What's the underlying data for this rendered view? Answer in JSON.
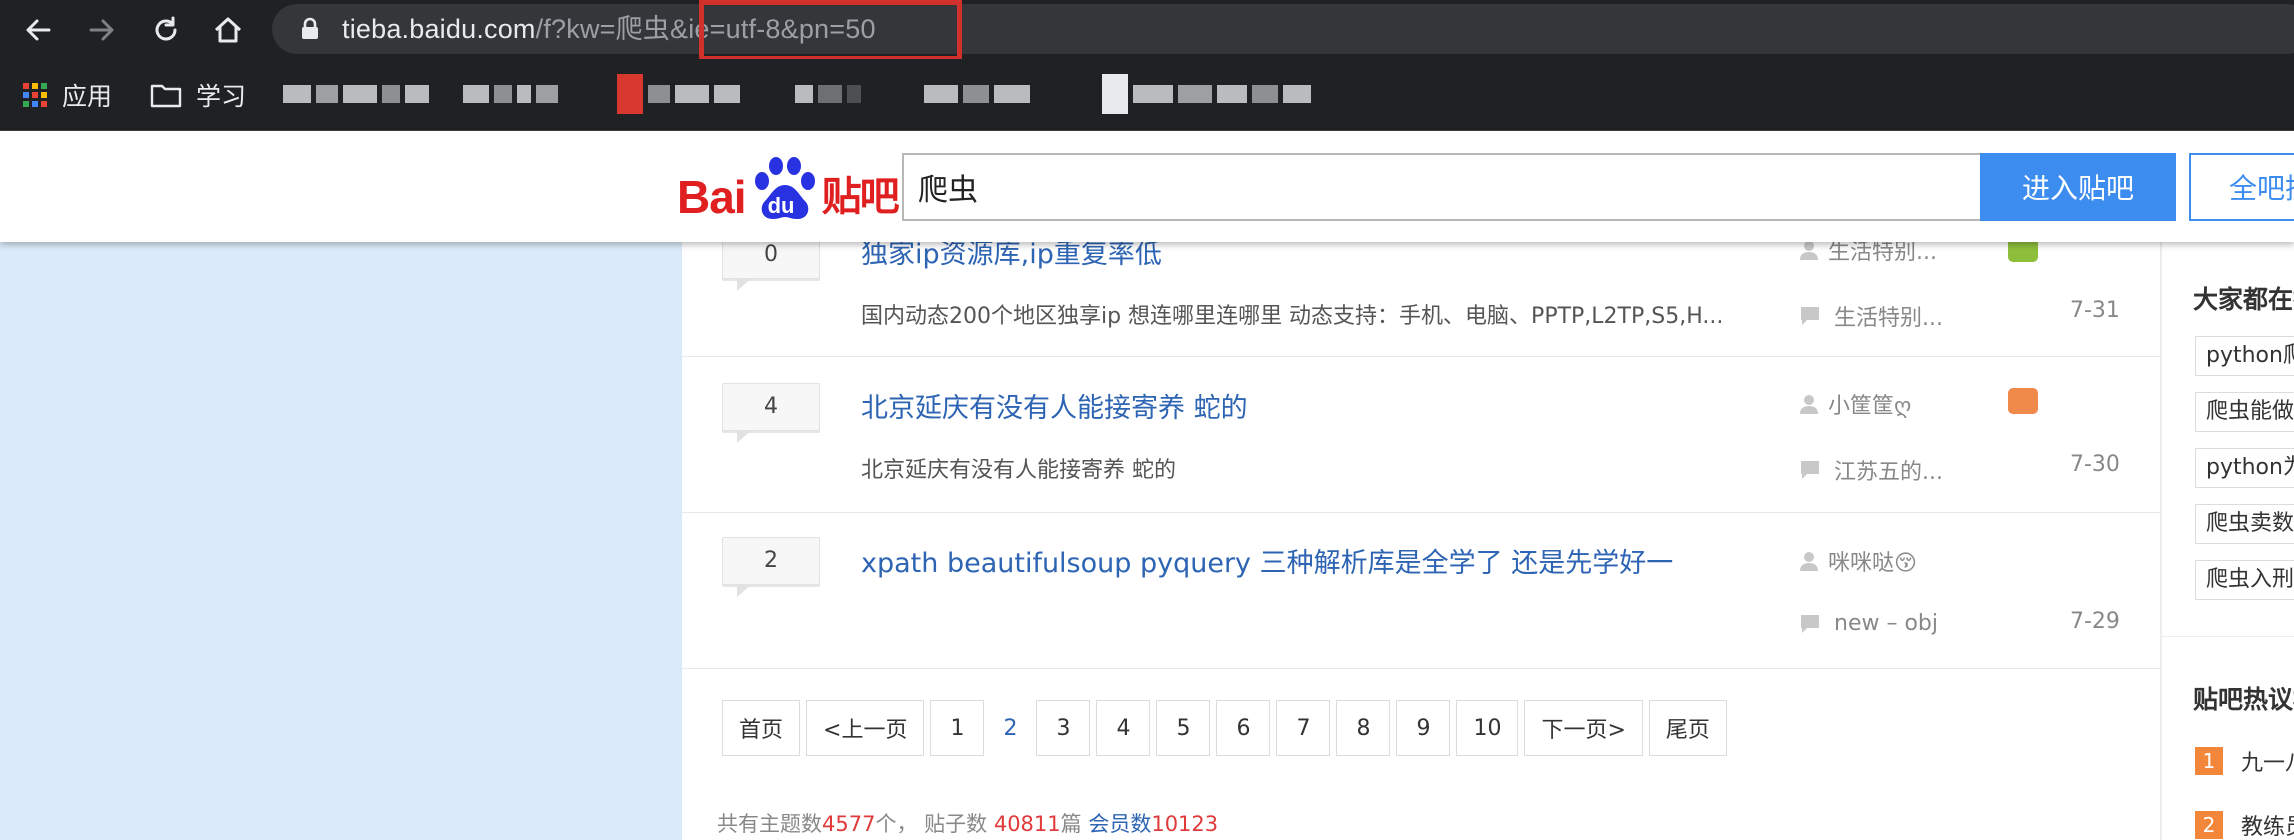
{
  "browser": {
    "url_host": "tieba.baidu.com",
    "url_path": "/f?kw=爬虫",
    "url_query": "&ie=utf-8&pn=50",
    "nav_icons": [
      "back-icon",
      "forward-icon",
      "reload-icon",
      "home-icon",
      "lock-icon"
    ],
    "highlight_color": "#d0312d"
  },
  "bookmarks": {
    "apps_label": "应用",
    "folder_label": "学习"
  },
  "header": {
    "logo_bai": "Bai",
    "logo_du": "du",
    "logo_tieba": "贴吧",
    "search_value": "爬虫",
    "enter_button": "进入贴吧",
    "all_button": "全吧搜索"
  },
  "threads": [
    {
      "replies": "0",
      "title": "独家ip资源库,ip重复率低",
      "abstract": "国内动态200个地区独享ip 想连哪里连哪里 动态支持：手机、电脑、PPTP,L2TP,S5,H...",
      "author": "生活特别...",
      "last_reply": "生活特别...",
      "date": "7-31"
    },
    {
      "replies": "4",
      "title": "北京延庆有没有人能接寄养 蛇的",
      "abstract": "北京延庆有没有人能接寄养 蛇的",
      "author": "小筐筐ღ",
      "last_reply": "江苏五的...",
      "date": "7-30"
    },
    {
      "replies": "2",
      "title": "xpath beautifulsoup pyquery 三种解析库是全学了 还是先学好一",
      "abstract": "",
      "author": "咪咪哒😚",
      "last_reply": "new – obj",
      "date": "7-29"
    }
  ],
  "pager": {
    "first": "首页",
    "prev": "<上一页",
    "pages": [
      "1",
      "2",
      "3",
      "4",
      "5",
      "6",
      "7",
      "8",
      "9",
      "10"
    ],
    "current": "2",
    "next": "下一页>",
    "last": "尾页"
  },
  "summary": {
    "topics_label": "共有主题数",
    "topics": "4577",
    "topics_unit": "个，",
    "posts_label": "贴子数",
    "posts": "40811",
    "posts_unit": "篇",
    "members_label": "会员数",
    "members": "10123"
  },
  "sidebar": {
    "everyone_heading": "大家都在搜",
    "tags": [
      "python爬虫",
      "爬虫能做",
      "python为",
      "爬虫卖数",
      "爬虫入刑"
    ],
    "hot_heading": "贴吧热议榜",
    "hot_items": [
      {
        "rank": "1",
        "text": "九一八"
      },
      {
        "rank": "2",
        "text": "教练员"
      }
    ]
  },
  "colors": {
    "link_blue": "#2d64b3",
    "button_blue": "#3d8df0",
    "brand_red": "#e02020",
    "left_bg": "#dbeaf9",
    "hot_orange": "#f2873b"
  }
}
